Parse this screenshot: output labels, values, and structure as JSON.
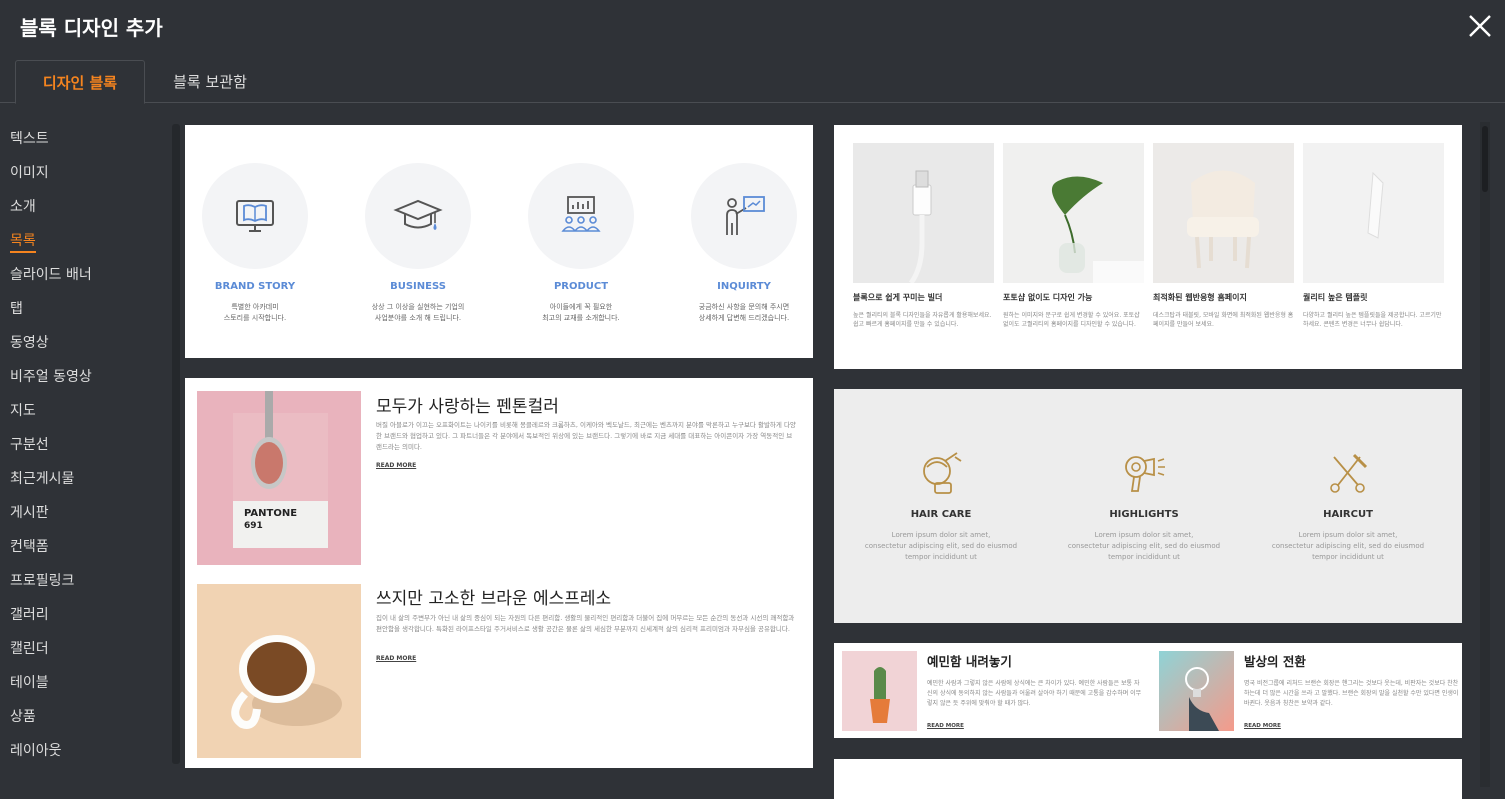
{
  "header": {
    "title": "블록 디자인 추가"
  },
  "tabs": [
    {
      "label": "디자인 블록"
    },
    {
      "label": "블록 보관함"
    }
  ],
  "sidebar": {
    "items": [
      {
        "label": "텍스트"
      },
      {
        "label": "이미지"
      },
      {
        "label": "소개"
      },
      {
        "label": "목록"
      },
      {
        "label": "슬라이드 배너"
      },
      {
        "label": "탭"
      },
      {
        "label": "동영상"
      },
      {
        "label": "비주얼 동영상"
      },
      {
        "label": "지도"
      },
      {
        "label": "구분선"
      },
      {
        "label": "최근게시물"
      },
      {
        "label": "게시판"
      },
      {
        "label": "컨택폼"
      },
      {
        "label": "프로필링크"
      },
      {
        "label": "갤러리"
      },
      {
        "label": "캘린더"
      },
      {
        "label": "테이블"
      },
      {
        "label": "상품"
      },
      {
        "label": "레이아웃"
      }
    ],
    "selected": "목록"
  },
  "block_icons": {
    "items": [
      {
        "title": "BRAND STORY",
        "desc": "특별한 아카데미\n스토리를 시작합니다."
      },
      {
        "title": "BUSINESS",
        "desc": "상상 그 이상을 실현하는 기업의\n사업분야를 소개 해 드립니다."
      },
      {
        "title": "PRODUCT",
        "desc": "아이들에게 꼭 필요한\n최고의 교재를 소개합니다."
      },
      {
        "title": "INQUIRTY",
        "desc": "궁금하신 사항을 문의해 주시면\n상세하게 답변해 드리겠습니다."
      }
    ],
    "accent": "#5b8bd6"
  },
  "block_photos": {
    "items": [
      {
        "title": "블록으로 쉽게 꾸미는 빌더",
        "desc": "높은 퀄리티의 블록 디자인들을 자유롭게 활용해보세요. 쉽고 빠르게 홈페이지를 만들 수 있습니다."
      },
      {
        "title": "포토샵 없이도 디자인 가능",
        "desc": "원하는 이미지와 문구로 쉽게 변경할 수 있어요. 포토샵 없이도 고퀄리티의 홈페이지를 디자인할 수 있습니다."
      },
      {
        "title": "최적화된 웹반응형 홈페이지",
        "desc": "데스크탑과 태블릿, 모바일 화면에 최적화된 웹반응형 홈페이지를 만들어 보세요."
      },
      {
        "title": "퀄리티 높은 템플릿",
        "desc": "다양하고 퀄리티 높은 템플릿들을 제공합니다. 고르기만 하세요. 콘텐츠 변경은 너무나 쉽답니다."
      }
    ]
  },
  "block_articles": {
    "read_more": "READ MORE",
    "items": [
      {
        "title": "모두가 사랑하는 펜톤컬러",
        "desc": "버질 아블로가 이끄는 오프화이트는 나이키를 비롯해 몽클레르와 크롬하츠, 이케아와 벡도날드, 최근에는 벤츠까지 분야를 막론하고 누구보다 활발하게 다양한 브랜드와 협업하고 있다. 그 파트너들은 각 분야에서 독보적인 위상에 있는 브랜드다. 그렇기에 바로 지금 세대를 대표하는 아이콘이자 가장 역동적인 브랜드라는 의미다."
      },
      {
        "title": "쓰지만 고소한 브라운 에스프레소",
        "desc": "집이 내 삶의 주변부가 아닌 내 삶의 중심이 되는 자원의 다른 편리함. 생활의 물리적인 편리함과 더불어 집에 머무르는 모든 순간의 동선과 시선의 쾌적함과 편안함을 생각합니다. 특화된 라이프스타일 주거서비스로 생활 공간은 물론 삶의 세심한 부분까지 신세계적 삶의 심리적 프리미엄과 자부심을 공유합니다."
      }
    ],
    "pantone_label": "PANTONE",
    "pantone_code": "691"
  },
  "block_hair": {
    "items": [
      {
        "title": "HAIR CARE",
        "desc": "Lorem ipsum dolor sit amet,\nconsectetur adipiscing elit, sed do eiusmod\ntempor incididunt ut"
      },
      {
        "title": "HIGHLIGHTS",
        "desc": "Lorem ipsum dolor sit amet,\nconsectetur adipiscing elit, sed do eiusmod\ntempor incididunt ut"
      },
      {
        "title": "HAIRCUT",
        "desc": "Lorem ipsum dolor sit amet,\nconsectetur adipiscing elit, sed do eiusmod\ntempor incididunt ut"
      }
    ],
    "accent": "#b89047"
  },
  "block_small": {
    "read_more": "READ MORE",
    "items": [
      {
        "title": "예민함 내려놓기",
        "desc": "예민한 사람과 그렇지 않은 사람에 상식에는 큰 차이가 있다. 예민한 사람들은 보통 자신의 상식에 동의하지 않는 사람들과 어울려 살아야 하기 때문에 고통을 감수하며 이무렇지 않은 듯 주위에 맞춰야 할 때가 많다."
      },
      {
        "title": "발상의 전환",
        "desc": "명국 비전그룹에 리처드 브랜슨 회장은 핸그리는 것보다 웃는데, 비판자는 것보다 찬찬하는데 더 많은 시간을 쓰라 고 말했다. 브랜슨 회장의 말을 실천할 수만 있다면 인생이 바뀐다. 웃음과 칭찬은 보약과 같다."
      }
    ]
  }
}
